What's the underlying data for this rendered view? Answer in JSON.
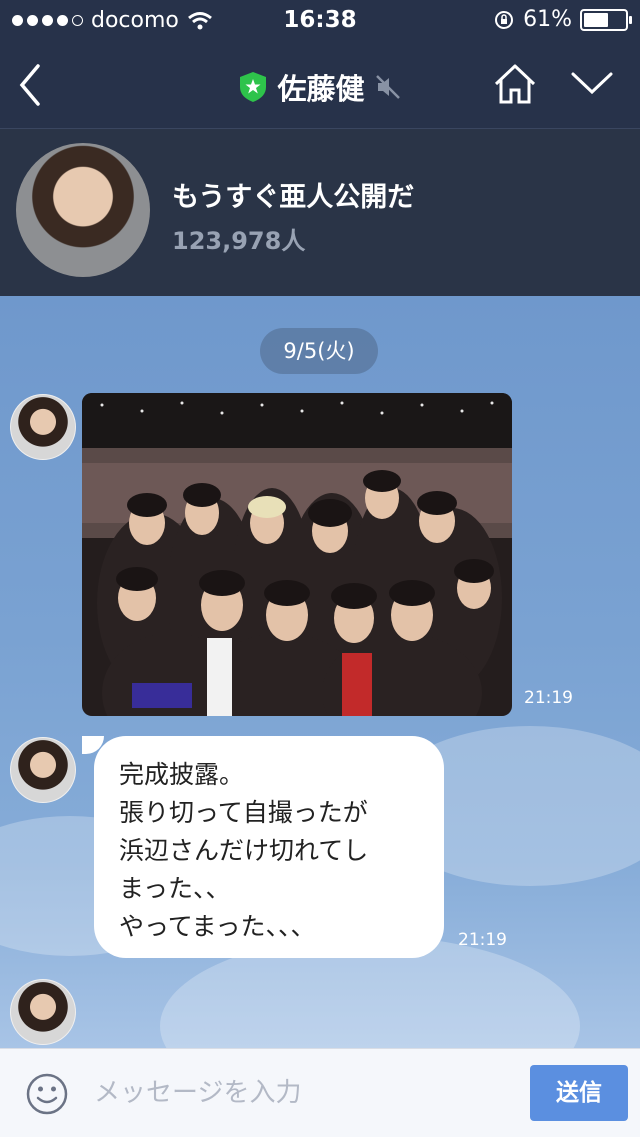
{
  "status_bar": {
    "carrier": "docomo",
    "time": "16:38",
    "battery_percent_text": "61%",
    "battery_level": 0.61,
    "signal_bars_filled": 4,
    "signal_bars_total": 5
  },
  "nav": {
    "back_icon": "chevron-left-icon",
    "verified_badge_icon": "star-shield-icon",
    "title": "佐藤健",
    "mute_icon": "speaker-muted-icon",
    "home_icon": "home-icon",
    "dropdown_icon": "chevron-down-icon"
  },
  "profile": {
    "status_message": "もうすぐ亜人公開だ",
    "followers": "123,978人"
  },
  "chat": {
    "date_divider": "9/5(火)",
    "messages": [
      {
        "type": "image",
        "time": "21:19"
      },
      {
        "type": "text",
        "text": "完成披露。\n張り切って自撮ったが\n浜辺さんだけ切れてし\nまった、、\nやってまった、、、",
        "time": "21:19"
      }
    ]
  },
  "input": {
    "emoji_icon": "smiley-icon",
    "placeholder": "メッセージを入力",
    "send_label": "送信"
  },
  "colors": {
    "header_bg": "#27324a",
    "chat_bg": "#7aa2d2",
    "send_button": "#5b8fe0",
    "verified_green": "#2ec34b"
  }
}
